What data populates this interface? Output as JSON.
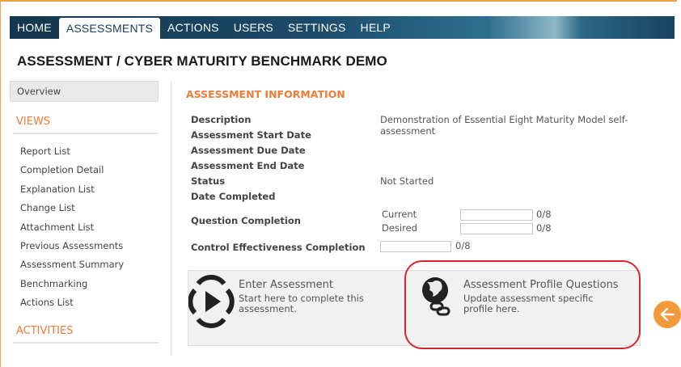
{
  "nav": {
    "tabs": [
      "HOME",
      "ASSESSMENTS",
      "ACTIONS",
      "USERS",
      "SETTINGS",
      "HELP"
    ],
    "active": "ASSESSMENTS"
  },
  "page_title": "ASSESSMENT / CYBER MATURITY BENCHMARK DEMO",
  "sidebar": {
    "overview": "Overview",
    "views_heading": "VIEWS",
    "views": [
      "Report List",
      "Completion Detail",
      "Explanation List",
      "Change List",
      "Attachment List",
      "Previous Assessments",
      "Assessment Summary",
      "Benchmarking",
      "Actions List"
    ],
    "activities_heading": "ACTIVITIES"
  },
  "info": {
    "heading": "ASSESSMENT INFORMATION",
    "description_label": "Description",
    "description_value": "Demonstration of Essential Eight Maturity Model self-assessment",
    "start_date_label": "Assessment Start Date",
    "due_date_label": "Assessment Due Date",
    "end_date_label": "Assessment End Date",
    "status_label": "Status",
    "status_value": "Not Started",
    "date_completed_label": "Date Completed",
    "question_completion_label": "Question Completion",
    "current_label": "Current",
    "current_value": "0/8",
    "current_progress": 0,
    "desired_label": "Desired",
    "desired_value": "0/8",
    "desired_progress": 0,
    "control_effectiveness_label": "Control Effectiveness Completion",
    "control_value": "0/8",
    "control_progress": 0
  },
  "cards": {
    "enter": {
      "title": "Enter Assessment",
      "description": "Start here to complete this assessment.",
      "icon": "play-circle-icon"
    },
    "profile": {
      "title": "Assessment Profile Questions",
      "description": "Update assessment specific profile here.",
      "icon": "globe-link-icon"
    }
  },
  "colors": {
    "accent_orange": "#f07a36",
    "nav_dark": "#14364e",
    "highlight_red": "#d7262e",
    "back_button": "#f29a3a"
  }
}
